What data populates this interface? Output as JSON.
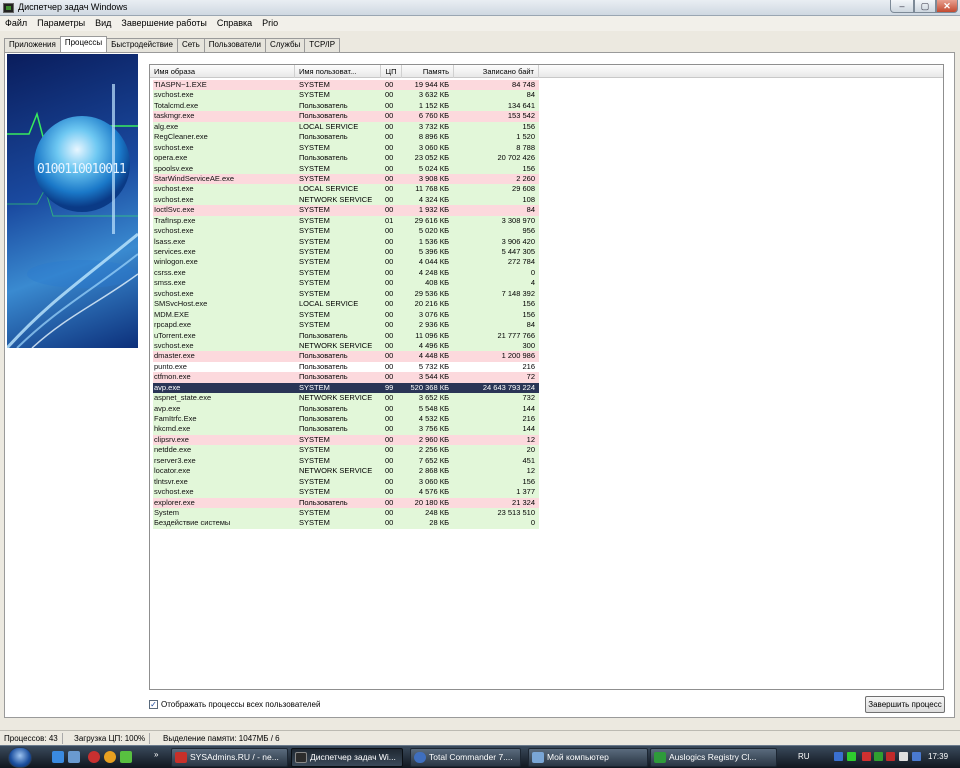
{
  "window": {
    "title": "Диспетчер задач Windows",
    "min": "–",
    "max": "▢",
    "close": "✕"
  },
  "menu": [
    "Файл",
    "Параметры",
    "Вид",
    "Завершение работы",
    "Справка",
    "Prio"
  ],
  "tabs": [
    {
      "label": "Приложения",
      "active": false
    },
    {
      "label": "Процессы",
      "active": true
    },
    {
      "label": "Быстродействие",
      "active": false
    },
    {
      "label": "Сеть",
      "active": false
    },
    {
      "label": "Пользователи",
      "active": false
    },
    {
      "label": "Службы",
      "active": false
    },
    {
      "label": "TCP/IP",
      "active": false
    }
  ],
  "sidebar": {
    "binary_text": "0100110010011"
  },
  "columns": [
    "Имя образа",
    "Имя пользоват...",
    "ЦП",
    "Память",
    "Записано байт"
  ],
  "row_colors": {
    "green": "#e2f7d9",
    "pink": "#fcd9dd",
    "white": "#ffffff",
    "selected": "#2a3556"
  },
  "processes": [
    {
      "name": "TIASPN~1.EXE",
      "user": "SYSTEM",
      "cpu": "00",
      "mem": "19 944 КБ",
      "written": "84 748",
      "color": "pink"
    },
    {
      "name": "svchost.exe",
      "user": "SYSTEM",
      "cpu": "00",
      "mem": "3 632 КБ",
      "written": "84",
      "color": "green"
    },
    {
      "name": "Totalcmd.exe",
      "user": "Пользователь",
      "cpu": "00",
      "mem": "1 152 КБ",
      "written": "134 641",
      "color": "green"
    },
    {
      "name": "taskmgr.exe",
      "user": "Пользователь",
      "cpu": "00",
      "mem": "6 760 КБ",
      "written": "153 542",
      "color": "pink"
    },
    {
      "name": "alg.exe",
      "user": "LOCAL SERVICE",
      "cpu": "00",
      "mem": "3 732 КБ",
      "written": "156",
      "color": "green"
    },
    {
      "name": "RegCleaner.exe",
      "user": "Пользователь",
      "cpu": "00",
      "mem": "8 896 КБ",
      "written": "1 520",
      "color": "green"
    },
    {
      "name": "svchost.exe",
      "user": "SYSTEM",
      "cpu": "00",
      "mem": "3 060 КБ",
      "written": "8 788",
      "color": "green"
    },
    {
      "name": "opera.exe",
      "user": "Пользователь",
      "cpu": "00",
      "mem": "23 052 КБ",
      "written": "20 702 426",
      "color": "green"
    },
    {
      "name": "spoolsv.exe",
      "user": "SYSTEM",
      "cpu": "00",
      "mem": "5 024 КБ",
      "written": "156",
      "color": "green"
    },
    {
      "name": "StarWindServiceAE.exe",
      "user": "SYSTEM",
      "cpu": "00",
      "mem": "3 908 КБ",
      "written": "2 260",
      "color": "pink"
    },
    {
      "name": "svchost.exe",
      "user": "LOCAL SERVICE",
      "cpu": "00",
      "mem": "11 768 КБ",
      "written": "29 608",
      "color": "green"
    },
    {
      "name": "svchost.exe",
      "user": "NETWORK SERVICE",
      "cpu": "00",
      "mem": "4 324 КБ",
      "written": "108",
      "color": "green"
    },
    {
      "name": "IoctlSvc.exe",
      "user": "SYSTEM",
      "cpu": "00",
      "mem": "1 932 КБ",
      "written": "84",
      "color": "pink"
    },
    {
      "name": "TrafInsp.exe",
      "user": "SYSTEM",
      "cpu": "01",
      "mem": "29 616 КБ",
      "written": "3 308 970",
      "color": "green"
    },
    {
      "name": "svchost.exe",
      "user": "SYSTEM",
      "cpu": "00",
      "mem": "5 020 КБ",
      "written": "956",
      "color": "green"
    },
    {
      "name": "lsass.exe",
      "user": "SYSTEM",
      "cpu": "00",
      "mem": "1 536 КБ",
      "written": "3 906 420",
      "color": "green"
    },
    {
      "name": "services.exe",
      "user": "SYSTEM",
      "cpu": "00",
      "mem": "5 396 КБ",
      "written": "5 447 305",
      "color": "green"
    },
    {
      "name": "winlogon.exe",
      "user": "SYSTEM",
      "cpu": "00",
      "mem": "4 044 КБ",
      "written": "272 784",
      "color": "green"
    },
    {
      "name": "csrss.exe",
      "user": "SYSTEM",
      "cpu": "00",
      "mem": "4 248 КБ",
      "written": "0",
      "color": "green"
    },
    {
      "name": "smss.exe",
      "user": "SYSTEM",
      "cpu": "00",
      "mem": "408 КБ",
      "written": "4",
      "color": "green"
    },
    {
      "name": "svchost.exe",
      "user": "SYSTEM",
      "cpu": "00",
      "mem": "29 536 КБ",
      "written": "7 148 392",
      "color": "green"
    },
    {
      "name": "SMSvcHost.exe",
      "user": "LOCAL SERVICE",
      "cpu": "00",
      "mem": "20 216 КБ",
      "written": "156",
      "color": "green"
    },
    {
      "name": "MDM.EXE",
      "user": "SYSTEM",
      "cpu": "00",
      "mem": "3 076 КБ",
      "written": "156",
      "color": "green"
    },
    {
      "name": "rpcapd.exe",
      "user": "SYSTEM",
      "cpu": "00",
      "mem": "2 936 КБ",
      "written": "84",
      "color": "green"
    },
    {
      "name": "uTorrent.exe",
      "user": "Пользователь",
      "cpu": "00",
      "mem": "11 096 КБ",
      "written": "21 777 766",
      "color": "green"
    },
    {
      "name": "svchost.exe",
      "user": "NETWORK SERVICE",
      "cpu": "00",
      "mem": "4 496 КБ",
      "written": "300",
      "color": "green"
    },
    {
      "name": "dmaster.exe",
      "user": "Пользователь",
      "cpu": "00",
      "mem": "4 448 КБ",
      "written": "1 200 986",
      "color": "pink"
    },
    {
      "name": "punto.exe",
      "user": "Пользователь",
      "cpu": "00",
      "mem": "5 732 КБ",
      "written": "216",
      "color": "white"
    },
    {
      "name": "ctfmon.exe",
      "user": "Пользователь",
      "cpu": "00",
      "mem": "3 544 КБ",
      "written": "72",
      "color": "pink"
    },
    {
      "name": "avp.exe",
      "user": "SYSTEM",
      "cpu": "99",
      "mem": "520 368 КБ",
      "written": "24 643 793 224",
      "color": "selected"
    },
    {
      "name": "aspnet_state.exe",
      "user": "NETWORK SERVICE",
      "cpu": "00",
      "mem": "3 652 КБ",
      "written": "732",
      "color": "green"
    },
    {
      "name": "avp.exe",
      "user": "Пользователь",
      "cpu": "00",
      "mem": "5 548 КБ",
      "written": "144",
      "color": "green"
    },
    {
      "name": "FamItrfc.Exe",
      "user": "Пользователь",
      "cpu": "00",
      "mem": "4 532 КБ",
      "written": "216",
      "color": "green"
    },
    {
      "name": "hkcmd.exe",
      "user": "Пользователь",
      "cpu": "00",
      "mem": "3 756 КБ",
      "written": "144",
      "color": "green"
    },
    {
      "name": "clipsrv.exe",
      "user": "SYSTEM",
      "cpu": "00",
      "mem": "2 960 КБ",
      "written": "12",
      "color": "pink"
    },
    {
      "name": "netdde.exe",
      "user": "SYSTEM",
      "cpu": "00",
      "mem": "2 256 КБ",
      "written": "20",
      "color": "green"
    },
    {
      "name": "rserver3.exe",
      "user": "SYSTEM",
      "cpu": "00",
      "mem": "7 652 КБ",
      "written": "451",
      "color": "green"
    },
    {
      "name": "locator.exe",
      "user": "NETWORK SERVICE",
      "cpu": "00",
      "mem": "2 868 КБ",
      "written": "12",
      "color": "green"
    },
    {
      "name": "tlntsvr.exe",
      "user": "SYSTEM",
      "cpu": "00",
      "mem": "3 060 КБ",
      "written": "156",
      "color": "green"
    },
    {
      "name": "svchost.exe",
      "user": "SYSTEM",
      "cpu": "00",
      "mem": "4 576 КБ",
      "written": "1 377",
      "color": "green"
    },
    {
      "name": "explorer.exe",
      "user": "Пользователь",
      "cpu": "00",
      "mem": "20 180 КБ",
      "written": "21 324",
      "color": "pink"
    },
    {
      "name": "System",
      "user": "SYSTEM",
      "cpu": "00",
      "mem": "248 КБ",
      "written": "23 513 510",
      "color": "green"
    },
    {
      "name": "Бездействие системы",
      "user": "SYSTEM",
      "cpu": "00",
      "mem": "28 КБ",
      "written": "0",
      "color": "green"
    }
  ],
  "show_all": {
    "label": "Отображать процессы всех пользователей",
    "checked": true
  },
  "end_process_label": "Завершить процесс",
  "status": {
    "processes": "Процессов: 43",
    "cpu": "Загрузка ЦП: 100%",
    "memory": "Выделение памяти: 1047МБ / 6"
  },
  "taskbar": {
    "more": "»",
    "tasks": [
      {
        "label": "SYSAdmins.RU / - ne...",
        "icon_color": "#c8302a",
        "active": false
      },
      {
        "label": "Диспетчер задач Wi...",
        "icon_color": "#2c2c2c",
        "active": true
      },
      {
        "label": "Total Commander 7....",
        "icon_color": "#3f6fbf",
        "active": false
      },
      {
        "label": "Мой компьютер",
        "icon_color": "#7aa6d6",
        "active": false
      },
      {
        "label": "Auslogics Registry Cl...",
        "icon_color": "#2e9a3a",
        "active": false
      }
    ],
    "lang": "RU",
    "clock": "17:39"
  }
}
